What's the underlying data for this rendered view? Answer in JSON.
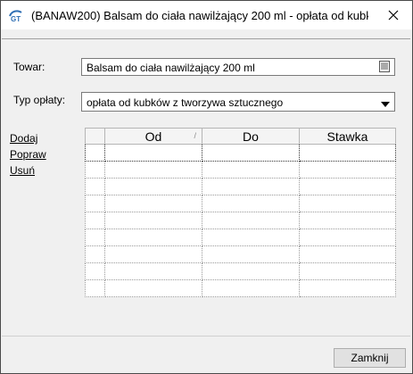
{
  "window": {
    "title": "(BANAW200) Balsam do ciała nawilżający 200 ml - opłata od kubk…",
    "icon": "gt-logo-icon",
    "close_icon": "close-icon"
  },
  "form": {
    "product_label": "Towar:",
    "product_value": "Balsam do ciała nawilżający 200 ml",
    "product_button_icon": "list-icon",
    "fee_type_label": "Typ opłaty:",
    "fee_type_value": "opłata od kubków z tworzywa sztucznego"
  },
  "actions": {
    "add": "Dodaj",
    "edit": "Popraw",
    "delete": "Usuń"
  },
  "table": {
    "columns": [
      "Od",
      "Do",
      "Stawka"
    ],
    "rows": []
  },
  "footer": {
    "close_button": "Zamknij"
  }
}
